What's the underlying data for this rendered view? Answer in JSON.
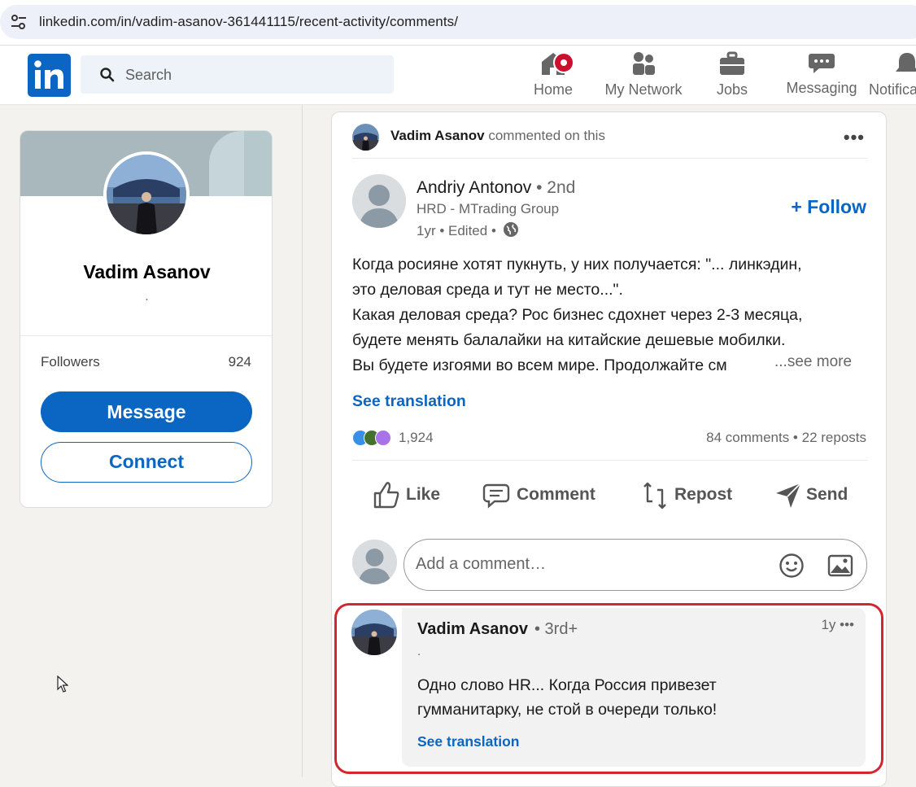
{
  "browser": {
    "url": "linkedin.com/in/vadim-asanov-361441115/recent-activity/comments/"
  },
  "nav": {
    "search_placeholder": "Search",
    "items": [
      {
        "label": "Home",
        "icon": "home-icon"
      },
      {
        "label": "My Network",
        "icon": "people-icon"
      },
      {
        "label": "Jobs",
        "icon": "briefcase-icon"
      },
      {
        "label": "Messaging",
        "icon": "chat-icon"
      },
      {
        "label": "Notifications",
        "icon": "bell-icon"
      }
    ]
  },
  "profile": {
    "name": "Vadim Asanov",
    "headline": ".",
    "followers_label": "Followers",
    "followers_count": "924",
    "message_label": "Message",
    "connect_label": "Connect"
  },
  "activity": {
    "actor": "Vadim Asanov",
    "action": "commented on this",
    "more": "•••"
  },
  "post": {
    "author_name": "Andriy Antonov",
    "author_degree": "• 2nd",
    "author_title": "HRD - MTrading Group",
    "meta": "1yr • Edited •",
    "follow_label": "+ Follow",
    "lines": [
      "Когда росияне хотят пукнуть, у них получается: \"... линкэдин,",
      "это деловая среда и тут не место...\".",
      "Какая деловая среда? Рос бизнес сдохнет через 2-3 месяца,",
      "будете менять балалайки на китайские дешевые мобилки.",
      "Вы будете изгоями во всем мире. Продолжайте см"
    ],
    "see_more": "...see more",
    "see_translation": "See translation",
    "reaction_count": "1,924",
    "comments_reposts": "84 comments • 22 reposts",
    "actions": {
      "like": "Like",
      "comment": "Comment",
      "repost": "Repost",
      "send": "Send"
    },
    "comment_placeholder": "Add a comment…"
  },
  "comment": {
    "author": "Vadim Asanov",
    "degree": "• 3rd+",
    "time": "1y •••",
    "headline": ".",
    "text_line1": "Одно слово HR... Когда Россия привезет",
    "text_line2": "гумманитарку, не стой в очереди только!",
    "see_translation": "See translation"
  },
  "colors": {
    "brand": "#0a66c2",
    "highlight": "#d22630",
    "badge": "#cb112d"
  }
}
